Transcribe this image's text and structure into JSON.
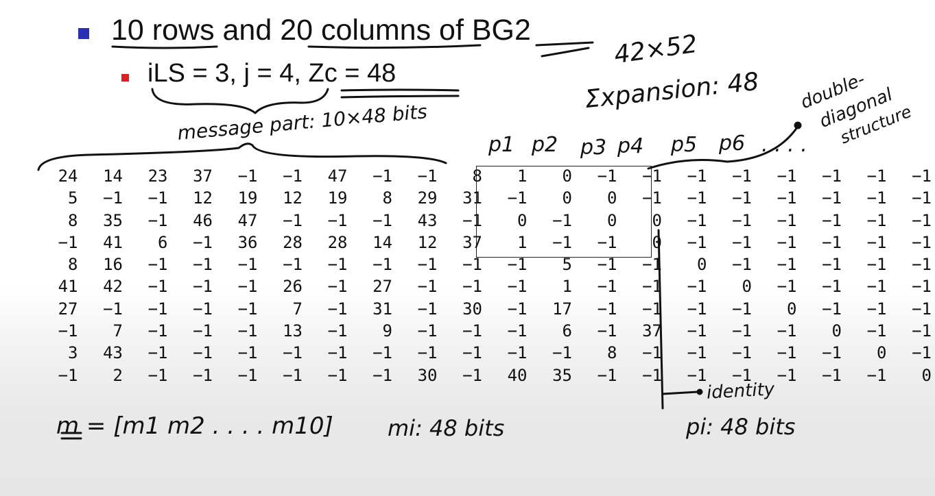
{
  "heading": {
    "main": "10 rows and 20 columns of BG2",
    "sub": "iLS = 3, j = 4, Zc = 48"
  },
  "annotations": {
    "size": "42×52",
    "expansion": "Σxpansion: 48",
    "double_diagonal_1": "double-",
    "double_diagonal_2": "diagonal",
    "double_diagonal_3": "structure",
    "message_part": "message part: 10×48 bits",
    "parity_labels": [
      "p1",
      "p2",
      "p3",
      "p4",
      "p5",
      "p6"
    ],
    "parity_dots": ". . . .",
    "identity": "identity",
    "m_vector": "m = [m1 m2 . . . . m10]",
    "mi_bits": "mi: 48 bits",
    "pi_bits": "pi: 48 bits"
  },
  "matrix": [
    [
      "24",
      "14",
      "23",
      "37",
      "−1",
      "−1",
      "47",
      "−1",
      "−1",
      "8",
      "1",
      "0",
      "−1",
      "−1",
      "−1",
      "−1",
      "−1",
      "−1",
      "−1",
      "−1"
    ],
    [
      "5",
      "−1",
      "−1",
      "12",
      "19",
      "12",
      "19",
      "8",
      "29",
      "31",
      "−1",
      "0",
      "0",
      "−1",
      "−1",
      "−1",
      "−1",
      "−1",
      "−1",
      "−1"
    ],
    [
      "8",
      "35",
      "−1",
      "46",
      "47",
      "−1",
      "−1",
      "−1",
      "43",
      "−1",
      "0",
      "−1",
      "0",
      "0",
      "−1",
      "−1",
      "−1",
      "−1",
      "−1",
      "−1"
    ],
    [
      "−1",
      "41",
      "6",
      "−1",
      "36",
      "28",
      "28",
      "14",
      "12",
      "37",
      "1",
      "−1",
      "−1",
      "0",
      "−1",
      "−1",
      "−1",
      "−1",
      "−1",
      "−1"
    ],
    [
      "8",
      "16",
      "−1",
      "−1",
      "−1",
      "−1",
      "−1",
      "−1",
      "−1",
      "−1",
      "−1",
      "5",
      "−1",
      "−1",
      "0",
      "−1",
      "−1",
      "−1",
      "−1",
      "−1"
    ],
    [
      "41",
      "42",
      "−1",
      "−1",
      "−1",
      "26",
      "−1",
      "27",
      "−1",
      "−1",
      "−1",
      "1",
      "−1",
      "−1",
      "−1",
      "0",
      "−1",
      "−1",
      "−1",
      "−1"
    ],
    [
      "27",
      "−1",
      "−1",
      "−1",
      "−1",
      "7",
      "−1",
      "31",
      "−1",
      "30",
      "−1",
      "17",
      "−1",
      "−1",
      "−1",
      "−1",
      "0",
      "−1",
      "−1",
      "−1"
    ],
    [
      "−1",
      "7",
      "−1",
      "−1",
      "−1",
      "13",
      "−1",
      "9",
      "−1",
      "−1",
      "−1",
      "6",
      "−1",
      "37",
      "−1",
      "−1",
      "−1",
      "0",
      "−1",
      "−1"
    ],
    [
      "3",
      "43",
      "−1",
      "−1",
      "−1",
      "−1",
      "−1",
      "−1",
      "−1",
      "−1",
      "−1",
      "−1",
      "8",
      "−1",
      "−1",
      "−1",
      "−1",
      "−1",
      "0",
      "−1"
    ],
    [
      "−1",
      "2",
      "−1",
      "−1",
      "−1",
      "−1",
      "−1",
      "−1",
      "30",
      "−1",
      "40",
      "35",
      "−1",
      "−1",
      "−1",
      "−1",
      "−1",
      "−1",
      "−1",
      "0"
    ]
  ],
  "colors": {
    "bullet_main": "#2b2fb5",
    "bullet_sub": "#e02020",
    "ink": "#111111"
  }
}
